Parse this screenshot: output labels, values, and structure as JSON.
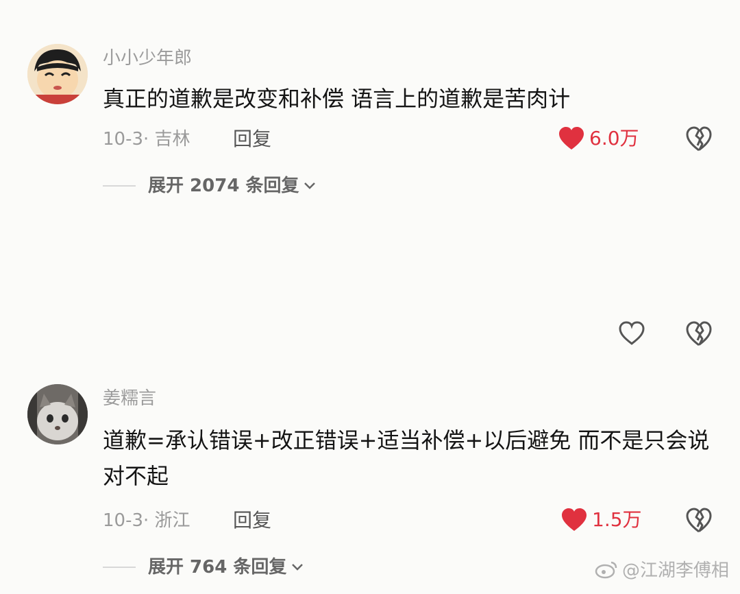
{
  "comments": [
    {
      "username": "小小少年郎",
      "text": "真正的道歉是改变和补偿  语言上的道歉是苦肉计",
      "date_location": "10-3· 吉林",
      "reply_label": "回复",
      "like_count": "6.0万",
      "expand_label": "展开 2074 条回复"
    },
    {
      "username": "姜糯言",
      "text": "道歉=承认错误+改正错误+适当补偿+以后避免 而不是只会说对不起",
      "date_location": "10-3· 浙江",
      "reply_label": "回复",
      "like_count": "1.5万",
      "expand_label": "展开 764 条回复"
    }
  ],
  "watermark": "@江湖李傅相",
  "colors": {
    "like_red": "#e0313f",
    "meta_gray": "#9a9a9a",
    "background": "#fbfbf9"
  },
  "icons": [
    "cartoon-avatar",
    "cat-avatar",
    "heart-filled-icon",
    "heart-outline-icon",
    "broken-heart-icon",
    "chevron-down-icon",
    "weibo-logo-icon"
  ]
}
